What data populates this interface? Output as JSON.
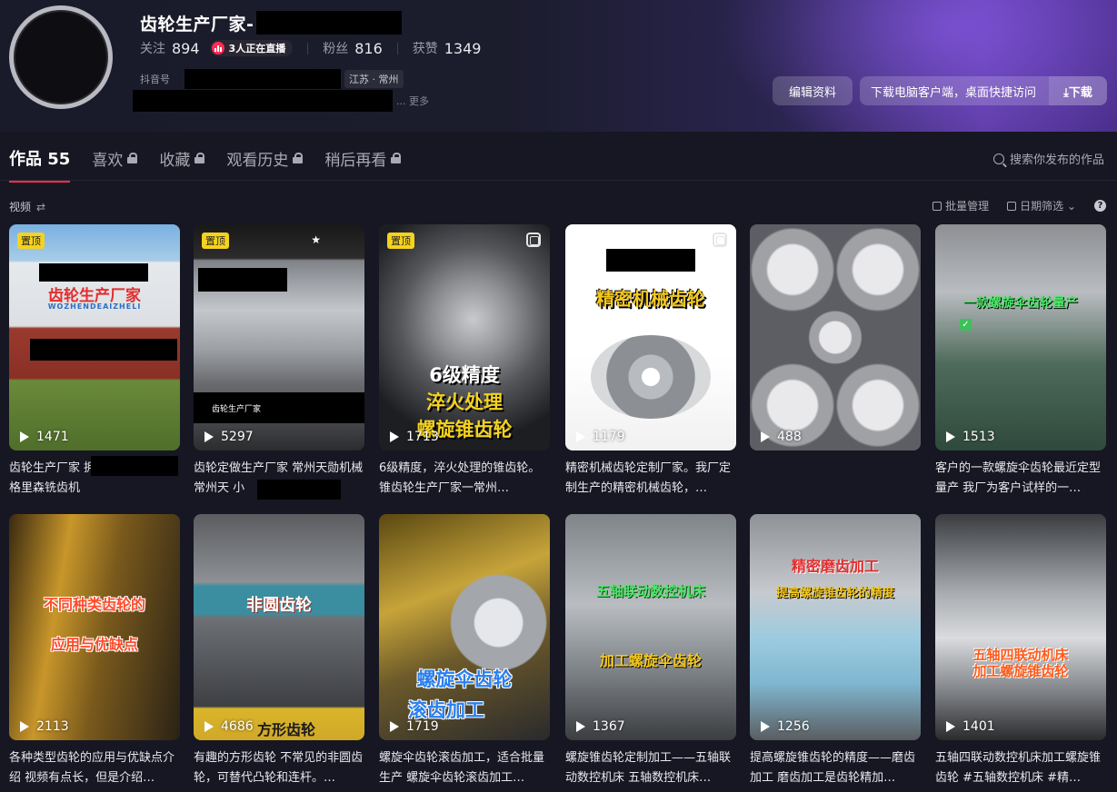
{
  "profile": {
    "name": "齿轮生产厂家-",
    "stats": {
      "follow_label": "关注",
      "follow_count": "894",
      "live_text": "3人正在直播",
      "fans_label": "粉丝",
      "fans_count": "816",
      "likes_label": "获赞",
      "likes_count": "1349"
    },
    "id_label": "抖音号",
    "location": "江苏 · 常州",
    "bio_more": "... 更多",
    "edit_button": "编辑资料",
    "download_prompt": "下载电脑客户端，桌面快捷访问",
    "download_button": "⤓下载"
  },
  "tabs": [
    {
      "label": "作品 55",
      "active": true,
      "locked": false
    },
    {
      "label": "喜欢",
      "active": false,
      "locked": true
    },
    {
      "label": "收藏",
      "active": false,
      "locked": true
    },
    {
      "label": "观看历史",
      "active": false,
      "locked": true
    },
    {
      "label": "稍后再看",
      "active": false,
      "locked": true
    }
  ],
  "search_placeholder": "搜索你发布的作品",
  "subbar": {
    "label": "视频",
    "filter_icon": "⇄"
  },
  "tools": {
    "batch": "批量管理",
    "date": "日期筛选 ⌄",
    "help": "?"
  },
  "colors": {
    "accent": "#fe2c55",
    "pin": "#f4d21f",
    "bg": "#161722"
  },
  "videos": [
    {
      "pinned": true,
      "pin_label": "置顶",
      "plays": "1471",
      "overlay": "齿轮生产厂家",
      "overlay2": "WOZHENDEAIZHELI",
      "desc": "齿轮生产厂家 拥有数十台小模数格里森铣齿机"
    },
    {
      "pinned": true,
      "pin_label": "置顶",
      "plays": "5297",
      "overlay": "齿轮生产厂家",
      "desc": "齿轮定做生产厂家 常州天勋机械 常州天 小"
    },
    {
      "pinned": true,
      "pin_label": "置顶",
      "plays": "1713",
      "overlay": "6级精度",
      "overlay2": "淬火处理",
      "overlay3": "螺旋锥齿轮",
      "desc": "6级精度，淬火处理的锥齿轮。锥齿轮生产厂家一常州…"
    },
    {
      "pinned": false,
      "plays": "1179",
      "overlay": "精密机械齿轮",
      "desc": "精密机械齿轮定制厂家。我厂定制生产的精密机械齿轮，…"
    },
    {
      "pinned": false,
      "plays": "488",
      "desc": ""
    },
    {
      "pinned": false,
      "plays": "1513",
      "overlay": "一款螺旋伞齿轮量产",
      "desc": "客户的一款螺旋伞齿轮最近定型量产 我厂为客户试样的一…"
    },
    {
      "pinned": false,
      "plays": "2113",
      "overlay": "不同种类齿轮的",
      "overlay2": "应用与优缺点",
      "desc": "各种类型齿轮的应用与优缺点介绍 视频有点长，但是介绍…"
    },
    {
      "pinned": false,
      "plays": "4686",
      "overlay": "非圆齿轮",
      "overlay2": "方形齿轮",
      "desc": "有趣的方形齿轮 不常见的非圆齿轮，可替代凸轮和连杆。…"
    },
    {
      "pinned": false,
      "plays": "1719",
      "overlay": "螺旋伞齿轮",
      "overlay2": "滚齿加工",
      "desc": "螺旋伞齿轮滚齿加工，适合批量生产 螺旋伞齿轮滚齿加工…"
    },
    {
      "pinned": false,
      "plays": "1367",
      "overlay": "五轴联动数控机床",
      "overlay2": "加工螺旋伞齿轮",
      "desc": "螺旋锥齿轮定制加工——五轴联动数控机床 五轴数控机床…"
    },
    {
      "pinned": false,
      "plays": "1256",
      "overlay": "精密磨齿加工",
      "overlay2": "提高螺旋锥齿轮的精度",
      "desc": "提高螺旋锥齿轮的精度——磨齿加工 磨齿加工是齿轮精加…"
    },
    {
      "pinned": false,
      "plays": "1401",
      "overlay": "五轴四联动机床",
      "overlay2": "加工螺旋锥齿轮",
      "desc": "五轴四联动数控机床加工螺旋锥齿轮 #五轴数控机床 #精…"
    }
  ]
}
